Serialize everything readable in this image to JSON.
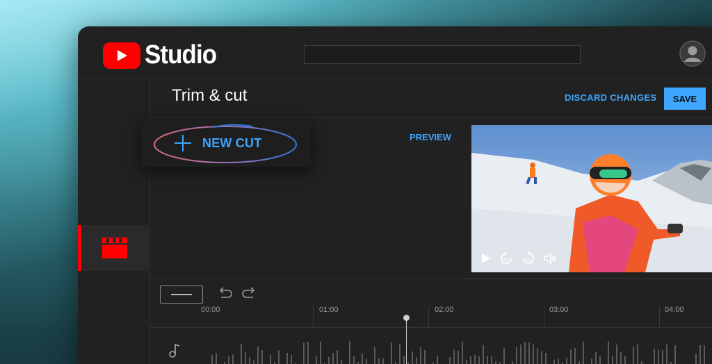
{
  "app": {
    "logo_text": "Studio"
  },
  "header": {
    "page_title": "Trim & cut",
    "discard_label": "DISCARD CHANGES",
    "save_label": "SAVE"
  },
  "editor": {
    "new_cut_label": "NEW CUT",
    "preview_label": "PREVIEW"
  },
  "timeline": {
    "markers": [
      "00:00",
      "01:00",
      "02:00",
      "03:00",
      "04:00"
    ]
  },
  "colors": {
    "accent": "#3ea6ff",
    "brand": "#ff0000",
    "background": "#212121"
  },
  "icons": {
    "logo": "youtube-play-icon",
    "avatar": "account-icon",
    "sidebar": "clapperboard-icon",
    "add": "plus-icon",
    "undo": "undo-icon",
    "redo": "redo-icon",
    "audio": "music-note-icon"
  }
}
